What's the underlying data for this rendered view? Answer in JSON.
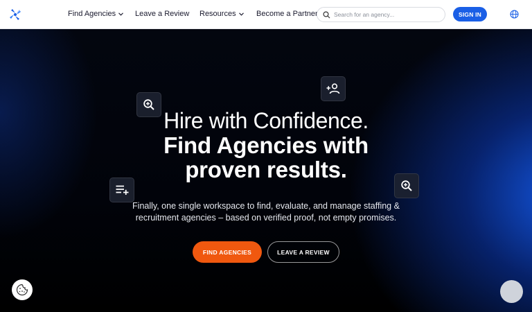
{
  "nav": {
    "logo_icon": "pinwheel-logo-icon",
    "links": [
      {
        "label": "Find Agencies",
        "dropdown": true
      },
      {
        "label": "Leave a Review",
        "dropdown": false
      },
      {
        "label": "Resources",
        "dropdown": true
      },
      {
        "label": "Become a Partner",
        "dropdown": false
      }
    ],
    "search_placeholder": "Search for an agency...",
    "signin_label": "SIGN IN",
    "globe_icon": "globe-icon"
  },
  "hero": {
    "headline_light": "Hire with Confidence.",
    "headline_bold_1": "Find Agencies with",
    "headline_bold_2": "proven results.",
    "sub_1": "Finally, one single workspace to find, evaluate, and manage staffing &",
    "sub_2": "recruitment agencies – based on verified proof, not empty promises.",
    "cta_primary": "FIND AGENCIES",
    "cta_secondary": "LEAVE A REVIEW",
    "floating_icons": [
      "zoom-in-icon",
      "add-person-icon",
      "playlist-add-icon",
      "zoom-in-icon"
    ]
  },
  "colors": {
    "brand_blue": "#1a5fe6",
    "cta_orange": "#f0580f",
    "hero_bg": "#000000"
  },
  "widgets": {
    "cookie_icon": "cookie-icon",
    "chat_icon": "chat-launcher"
  }
}
